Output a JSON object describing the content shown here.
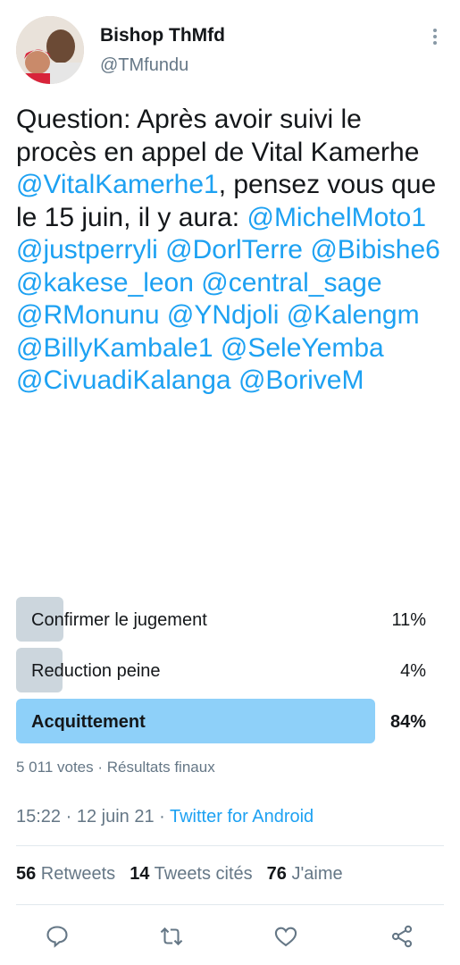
{
  "user": {
    "display_name": "Bishop ThMfd",
    "handle": "@TMfundu"
  },
  "tweet": {
    "segments": [
      {
        "text": "Question: Après avoir suivi le procès en appel de Vital Kamerhe ",
        "mention": false
      },
      {
        "text": "@VitalKamerhe1",
        "mention": true
      },
      {
        "text": ", pensez vous que le 15 juin, il y aura: ",
        "mention": false
      },
      {
        "text": "@MichelMoto1",
        "mention": true
      },
      {
        "text": " ",
        "mention": false
      },
      {
        "text": "@justperryli",
        "mention": true
      },
      {
        "text": " ",
        "mention": false
      },
      {
        "text": "@DorlTerre",
        "mention": true
      },
      {
        "text": " ",
        "mention": false
      },
      {
        "text": "@Bibishe6",
        "mention": true
      },
      {
        "text": " ",
        "mention": false
      },
      {
        "text": "@kakese_leon",
        "mention": true
      },
      {
        "text": " ",
        "mention": false
      },
      {
        "text": "@central_sage",
        "mention": true
      },
      {
        "text": " ",
        "mention": false
      },
      {
        "text": "@RMonunu",
        "mention": true
      },
      {
        "text": " ",
        "mention": false
      },
      {
        "text": "@YNdjoli",
        "mention": true
      },
      {
        "text": " ",
        "mention": false
      },
      {
        "text": "@Kalengm",
        "mention": true
      },
      {
        "text": " ",
        "mention": false
      },
      {
        "text": "@BillyKambale1",
        "mention": true
      },
      {
        "text": " ",
        "mention": false
      },
      {
        "text": "@SeleYemba",
        "mention": true
      },
      {
        "text": " ",
        "mention": false
      },
      {
        "text": "@CivuadiKalanga",
        "mention": true
      },
      {
        "text": " ",
        "mention": false
      },
      {
        "text": "@BoriveM",
        "mention": true
      }
    ]
  },
  "poll": {
    "options": [
      {
        "label": "Confirmer le jugement",
        "percent": "11%",
        "value": 11,
        "winner": false
      },
      {
        "label": "Reduction peine",
        "percent": "4%",
        "value": 4,
        "winner": false
      },
      {
        "label": "Acquittement",
        "percent": "84%",
        "value": 84,
        "winner": true
      }
    ],
    "meta": "5 011 votes · Résultats finaux"
  },
  "timestamp": {
    "time": "15:22 · 12 juin 21 · ",
    "source": "Twitter for Android"
  },
  "stats": {
    "retweets_count": "56",
    "retweets_label": " Retweets",
    "quotes_count": "14",
    "quotes_label": " Tweets cités",
    "likes_count": "76",
    "likes_label": " J'aime"
  },
  "colors": {
    "accent": "#1da1f2",
    "muted": "#657786",
    "poll_bar": "#ccd6dd",
    "poll_winner": "#8ed0f9"
  },
  "icons": [
    "more-vertical-icon",
    "reply-icon",
    "retweet-icon",
    "like-icon",
    "share-icon"
  ]
}
